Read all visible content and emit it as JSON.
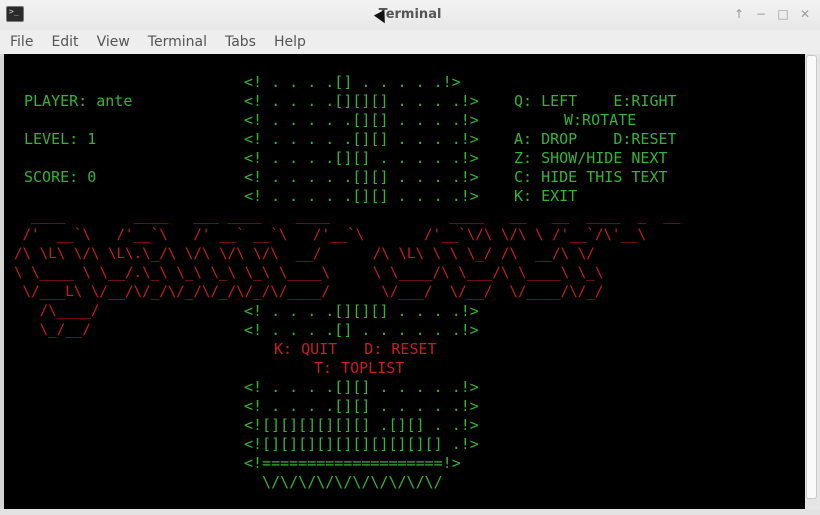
{
  "window": {
    "title": "Terminal"
  },
  "menu": [
    "File",
    "Edit",
    "View",
    "Terminal",
    "Tabs",
    "Help"
  ],
  "colors": {
    "green": "#33b533",
    "red": "#c81e1e",
    "background": "#000000"
  },
  "icons": {
    "app": "terminal-icon",
    "controls": [
      "keep-above-icon",
      "minimize-icon",
      "maximize-icon",
      "close-icon"
    ]
  },
  "terminal": {
    "info": [
      "PLAYER: ante",
      "LEVEL: 1",
      "SCORE: 0"
    ],
    "help": [
      "Q: LEFT    E:RIGHT",
      "W:ROTATE",
      "A: DROP    D:RESET",
      "Z: SHOW/HIDE NEXT",
      "C: HIDE THIS TEXT",
      "K: EXIT"
    ],
    "board_top": [
      "<! . . . .[] . . . . .!>",
      "<! . . . .[][][] . . . .!>",
      "<! . . . . .[][] . . . .!>",
      "<! . . . . .[][] . . . .!>",
      "<! . . . .[][] . . . . .!>",
      "<! . . . . .[][] . . . .!>",
      "<! . . . . .[][] . . . .!>"
    ],
    "game_over_art": [
      "  ____        ____   ___ ____    ____              ____   __   __  ____  _  __",
      " /'  __`\\   /'__`\\   /' __` __`\\   /'__`\\       /'__`\\/\\ \\/\\ \\ /'__`/\\'__\\",
      "/\\ \\L\\ \\/\\ \\L\\.\\_/\\ \\/\\ \\/\\ \\/\\  __/      /\\ \\L\\ \\ \\ \\_/ /\\  __/\\ \\/",
      "\\ \\____ \\ \\__/.\\_\\ \\_\\ \\_\\ \\_\\ \\____\\     \\ \\____/\\ \\___/\\ \\____\\ \\_\\",
      " \\/___L\\ \\/__/\\/_/\\/_/\\/_/\\/_/\\/____/      \\/___/  \\/__/  \\/____/\\/_/",
      "   /\\____/",
      "   \\_/__/"
    ],
    "board_mid": [
      "<! . . . .[][][] . . . .!>",
      "<! . . . .[] . . . . . .!>"
    ],
    "actions": [
      "K: QUIT   D: RESET",
      "T: TOPLIST"
    ],
    "board_bottom": [
      "<! . . . .[][] . . . . .!>",
      "<! . . . .[][] . . . . .!>",
      "<![][][][][][] .[][] . .!>",
      "<![][][][][][][][][][] .!>",
      "<!====================!>",
      "  \\/\\/\\/\\/\\/\\/\\/\\/\\/\\/"
    ]
  }
}
